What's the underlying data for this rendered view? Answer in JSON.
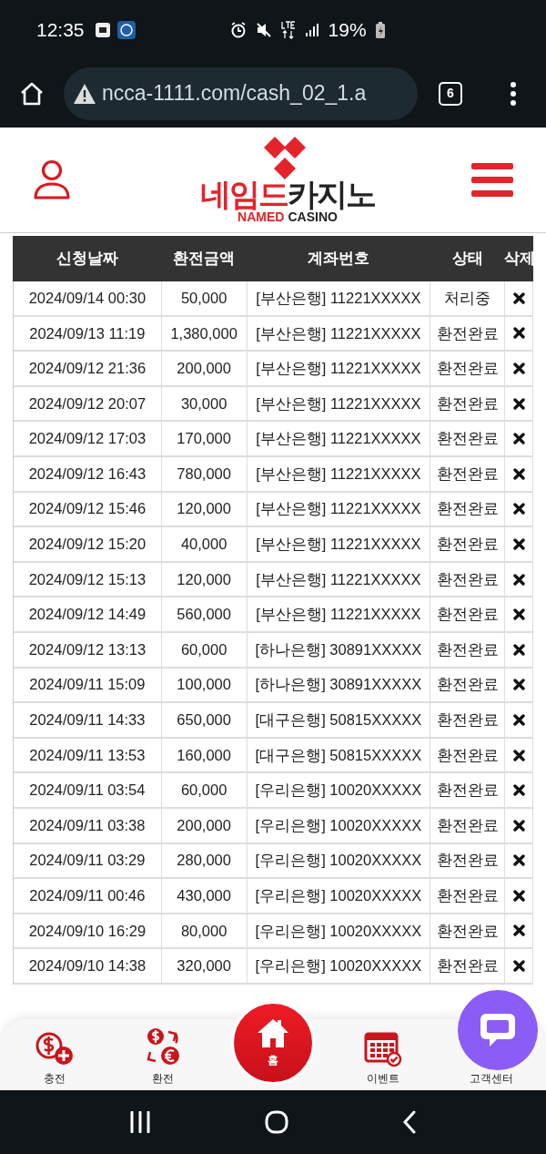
{
  "status_bar": {
    "time": "12:35",
    "battery": "19%"
  },
  "browser": {
    "url": "ncca-1111.com/cash_02_1.a",
    "tab_count": "6"
  },
  "logo": {
    "korean_red": "네임드",
    "korean_dark": "카지노",
    "english_red": "NAMED",
    "english_dark": "CASINO"
  },
  "table": {
    "columns": [
      "신청날짜",
      "환전금액",
      "계좌번호",
      "상태",
      "삭제"
    ],
    "rows": [
      {
        "date": "2024/09/14 00:30",
        "amount": "50,000",
        "account": "[부산은행] 11221XXXXX",
        "status": "처리중"
      },
      {
        "date": "2024/09/13 11:19",
        "amount": "1,380,000",
        "account": "[부산은행] 11221XXXXX",
        "status": "환전완료"
      },
      {
        "date": "2024/09/12 21:36",
        "amount": "200,000",
        "account": "[부산은행] 11221XXXXX",
        "status": "환전완료"
      },
      {
        "date": "2024/09/12 20:07",
        "amount": "30,000",
        "account": "[부산은행] 11221XXXXX",
        "status": "환전완료"
      },
      {
        "date": "2024/09/12 17:03",
        "amount": "170,000",
        "account": "[부산은행] 11221XXXXX",
        "status": "환전완료"
      },
      {
        "date": "2024/09/12 16:43",
        "amount": "780,000",
        "account": "[부산은행] 11221XXXXX",
        "status": "환전완료"
      },
      {
        "date": "2024/09/12 15:46",
        "amount": "120,000",
        "account": "[부산은행] 11221XXXXX",
        "status": "환전완료"
      },
      {
        "date": "2024/09/12 15:20",
        "amount": "40,000",
        "account": "[부산은행] 11221XXXXX",
        "status": "환전완료"
      },
      {
        "date": "2024/09/12 15:13",
        "amount": "120,000",
        "account": "[부산은행] 11221XXXXX",
        "status": "환전완료"
      },
      {
        "date": "2024/09/12 14:49",
        "amount": "560,000",
        "account": "[부산은행] 11221XXXXX",
        "status": "환전완료"
      },
      {
        "date": "2024/09/12 13:13",
        "amount": "60,000",
        "account": "[하나은행] 30891XXXXX",
        "status": "환전완료"
      },
      {
        "date": "2024/09/11 15:09",
        "amount": "100,000",
        "account": "[하나은행] 30891XXXXX",
        "status": "환전완료"
      },
      {
        "date": "2024/09/11 14:33",
        "amount": "650,000",
        "account": "[대구은행] 50815XXXXX",
        "status": "환전완료"
      },
      {
        "date": "2024/09/11 13:53",
        "amount": "160,000",
        "account": "[대구은행] 50815XXXXX",
        "status": "환전완료"
      },
      {
        "date": "2024/09/11 03:54",
        "amount": "60,000",
        "account": "[우리은행] 10020XXXXX",
        "status": "환전완료"
      },
      {
        "date": "2024/09/11 03:38",
        "amount": "200,000",
        "account": "[우리은행] 10020XXXXX",
        "status": "환전완료"
      },
      {
        "date": "2024/09/11 03:29",
        "amount": "280,000",
        "account": "[우리은행] 10020XXXXX",
        "status": "환전완료"
      },
      {
        "date": "2024/09/11 00:46",
        "amount": "430,000",
        "account": "[우리은행] 10020XXXXX",
        "status": "환전완료"
      },
      {
        "date": "2024/09/10 16:29",
        "amount": "80,000",
        "account": "[우리은행] 10020XXXXX",
        "status": "환전완료"
      },
      {
        "date": "2024/09/10 14:38",
        "amount": "320,000",
        "account": "[우리은행] 10020XXXXX",
        "status": "환전완료"
      }
    ]
  },
  "bottom_nav": [
    {
      "kind": "deposit",
      "label": "충전"
    },
    {
      "kind": "exchange",
      "label": "환전"
    },
    {
      "kind": "home",
      "label": "홈"
    },
    {
      "kind": "event",
      "label": "이벤트"
    },
    {
      "kind": "support",
      "label": "고객센터"
    }
  ]
}
